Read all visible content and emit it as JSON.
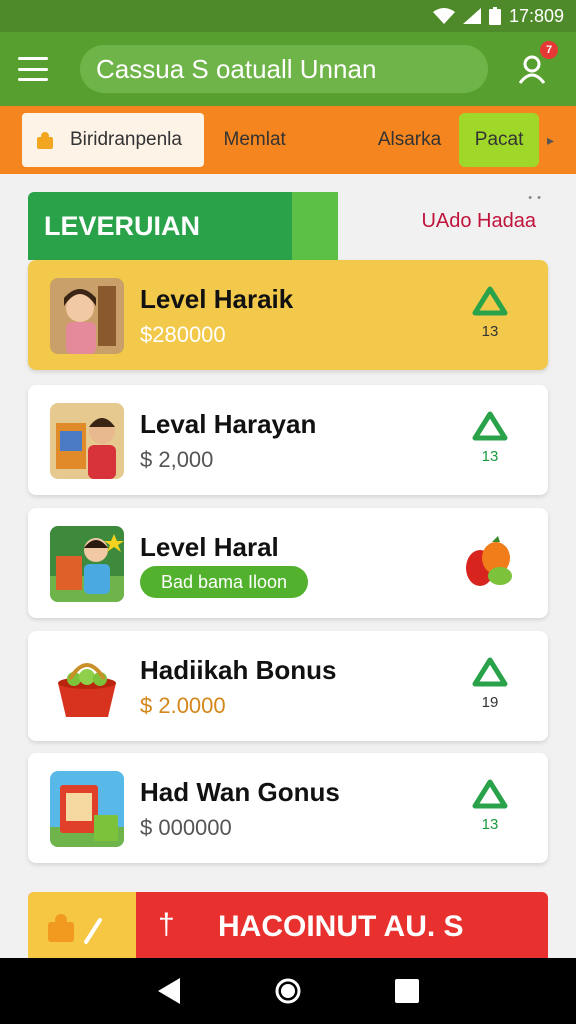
{
  "status_bar": {
    "time": "17:809"
  },
  "app_bar": {
    "search_text": "Cassua S oatuall Unnan",
    "notification_count": "7"
  },
  "tabs": [
    {
      "label": "Biridranpenla"
    },
    {
      "label": "Memlat"
    },
    {
      "label": "Alsarka"
    },
    {
      "label": "Pacat"
    }
  ],
  "section": {
    "title": "LEVERUIAN",
    "link": "UAdo Hadaa"
  },
  "items": [
    {
      "title": "Level Haraik",
      "price": "$280000",
      "rank": "13",
      "icon": "up-triangle-icon"
    },
    {
      "title": "Leval Harayan",
      "price": "$ 2,000",
      "rank": "13",
      "icon": "up-triangle-icon"
    },
    {
      "title": "Level Haral",
      "pill": "Bad bama Iloon",
      "icon": "fruit-icon"
    },
    {
      "title": "Hadiikah Bonus",
      "price": "$ 2.0000",
      "rank": "19",
      "icon": "up-triangle-icon"
    },
    {
      "title": "Had Wan Gonus",
      "price": "$ 000000",
      "rank": "13",
      "icon": "up-triangle-icon"
    }
  ],
  "banner": {
    "text": "HACOINUT AU. S",
    "mark": "†"
  },
  "colors": {
    "appbar": "#57a02f",
    "tabs": "#f5861f",
    "highlight": "#f2c94a",
    "banner": "#e8302e"
  }
}
